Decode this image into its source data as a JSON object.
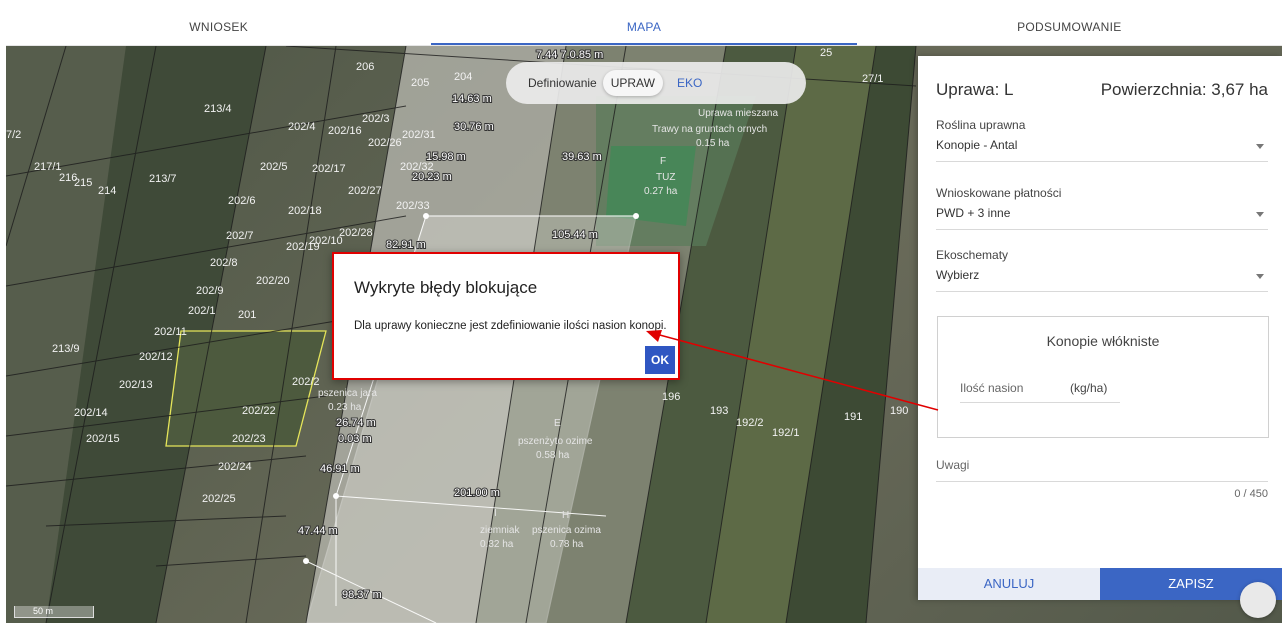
{
  "tabs": [
    {
      "label": "WNIOSEK",
      "active": false
    },
    {
      "label": "MAPA",
      "active": true
    },
    {
      "label": "PODSUMOWANIE",
      "active": false
    }
  ],
  "toggle": {
    "label": "Definiowanie",
    "option_on": "UPRAW",
    "option_off": "EKO"
  },
  "map": {
    "parcel_labels": [
      "206",
      "205",
      "204",
      "213/4",
      "202/4",
      "202/16",
      "202/31",
      "202/3",
      "202/26",
      "202/5",
      "202/17",
      "202/32",
      "217/1",
      "216",
      "215",
      "214",
      "213/7",
      "202/6",
      "202/18",
      "202/27",
      "202/33",
      "202/7",
      "202/19",
      "202/10",
      "202/28",
      "202/8",
      "202/20",
      "202/9",
      "202/1",
      "201",
      "202/11",
      "213/9",
      "202/12",
      "202/13",
      "202/14",
      "202/22",
      "202/15",
      "202/23",
      "202/24",
      "202/25",
      "196",
      "193",
      "192/2",
      "192/1",
      "191",
      "190",
      "25",
      "27/1",
      "7/2",
      "202/2"
    ],
    "measurements": [
      "7.44 7.0.85 m",
      "14.63 m",
      "30.76 m",
      "15.98 m",
      "20.23 m",
      "39.63 m",
      "105.44 m",
      "82.91 m",
      "26.74 m",
      "0.03 m",
      "46.91 m",
      "201.00 m",
      "47.44 m",
      "98.37 m"
    ],
    "polygon_labels": [
      {
        "line1": "Trawy na gruntach ornych",
        "line2": "0.15 ha"
      },
      {
        "line1": "Uprawa mieszana",
        "line2": ""
      },
      {
        "line1": "F",
        "line2": ""
      },
      {
        "line1": "TUZ",
        "line2": "0.27 ha"
      },
      {
        "line1": "pszenica jara",
        "line2": "0.23 ha"
      },
      {
        "line1": "E",
        "line2": ""
      },
      {
        "line1": "pszenżyto ozime",
        "line2": "0.58 ha"
      },
      {
        "line1": "I",
        "line2": ""
      },
      {
        "line1": "ziemniak",
        "line2": "0.32 ha"
      },
      {
        "line1": "H",
        "line2": ""
      },
      {
        "line1": "pszenica ozima",
        "line2": "0.78 ha"
      }
    ],
    "scale": "50 m"
  },
  "panel": {
    "title": "Uprawa: L",
    "area": "Powierzchnia: 3,67 ha",
    "fields": [
      {
        "label": "Roślina uprawna",
        "value": "Konopie - Antal"
      },
      {
        "label": "Wnioskowane płatności",
        "value": "PWD + 3 inne"
      },
      {
        "label": "Ekoschematy",
        "value": "Wybierz"
      }
    ],
    "subsection": {
      "title": "Konopie włókniste",
      "input_label": "Ilość nasion",
      "unit": "(kg/ha)"
    },
    "notes_label": "Uwagi",
    "notes_counter": "0 / 450",
    "cancel_label": "ANULUJ",
    "save_label": "ZAPISZ"
  },
  "modal": {
    "title": "Wykryte błędy blokujące",
    "message": "Dla uprawy konieczne jest zdefiniowanie ilości nasion konopi.",
    "ok_label": "OK"
  },
  "colors": {
    "accent": "#3b66c4",
    "error_border": "#e00000",
    "ok_button": "#2f56c2"
  }
}
